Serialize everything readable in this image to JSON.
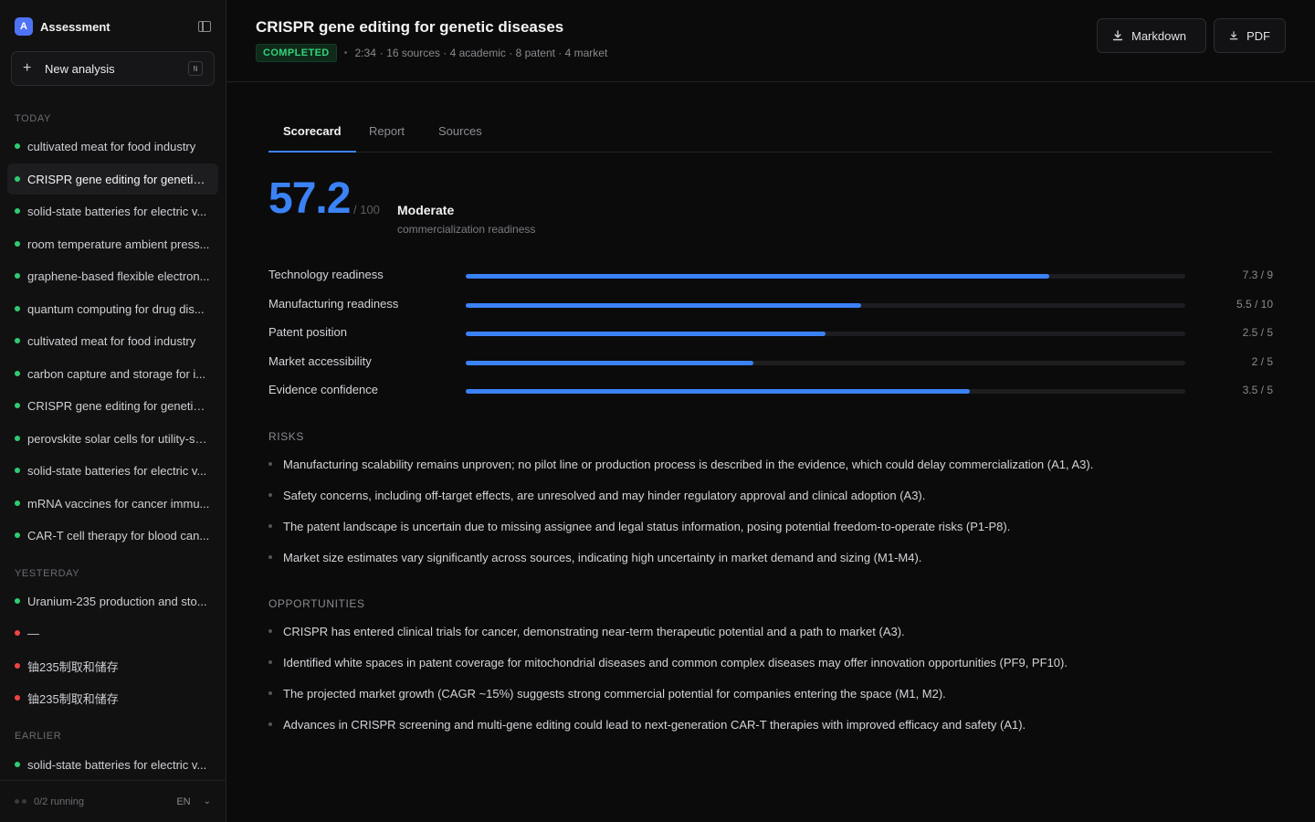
{
  "app": {
    "logo_letter": "A",
    "title": "Assessment"
  },
  "sidebar": {
    "new_analysis_label": "New analysis",
    "new_analysis_shortcut": "N",
    "sections": {
      "today": "TODAY",
      "yesterday": "YESTERDAY",
      "earlier": "EARLIER"
    },
    "today": [
      {
        "label": "cultivated meat for food industry",
        "status": "green"
      },
      {
        "label": "CRISPR gene editing for genetic ...",
        "status": "green",
        "active": true
      },
      {
        "label": "solid-state batteries for electric v...",
        "status": "green"
      },
      {
        "label": "room temperature ambient press...",
        "status": "green"
      },
      {
        "label": "graphene-based flexible electron...",
        "status": "green"
      },
      {
        "label": "quantum computing for drug dis...",
        "status": "green"
      },
      {
        "label": "cultivated meat for food industry",
        "status": "green"
      },
      {
        "label": "carbon capture and storage for i...",
        "status": "green"
      },
      {
        "label": "CRISPR gene editing for genetic ...",
        "status": "green"
      },
      {
        "label": "perovskite solar cells for utility-sc...",
        "status": "green"
      },
      {
        "label": "solid-state batteries for electric v...",
        "status": "green"
      },
      {
        "label": "mRNA vaccines for cancer immu...",
        "status": "green"
      },
      {
        "label": "CAR-T cell therapy for blood can...",
        "status": "green"
      }
    ],
    "yesterday": [
      {
        "label": "Uranium-235 production and sto...",
        "status": "green"
      },
      {
        "label": "—",
        "status": "red"
      },
      {
        "label": "铀235制取和储存",
        "status": "red"
      },
      {
        "label": "铀235制取和储存",
        "status": "red"
      }
    ],
    "earlier": [
      {
        "label": "solid-state batteries for electric v...",
        "status": "green"
      }
    ],
    "footer": {
      "running": "0/2 running",
      "language": "EN"
    }
  },
  "header": {
    "title": "CRISPR gene editing for genetic diseases",
    "status": "COMPLETED",
    "duration": "2:34",
    "sources_summary": "· 16 sources · 4 academic · 8 patent · 4 market",
    "buttons": {
      "markdown": "Markdown",
      "pdf": "PDF"
    }
  },
  "tabs": [
    "Scorecard",
    "Report",
    "Sources"
  ],
  "score": {
    "value": "57.2",
    "max": "/ 100",
    "level": "Moderate",
    "subtitle": "commercialization readiness"
  },
  "metrics": [
    {
      "label": "Technology readiness",
      "value": "7.3 / 9",
      "fraction": 0.811
    },
    {
      "label": "Manufacturing readiness",
      "value": "5.5 / 10",
      "fraction": 0.55
    },
    {
      "label": "Patent position",
      "value": "2.5 / 5",
      "fraction": 0.5
    },
    {
      "label": "Market accessibility",
      "value": "2 / 5",
      "fraction": 0.4
    },
    {
      "label": "Evidence confidence",
      "value": "3.5 / 5",
      "fraction": 0.7
    }
  ],
  "risks": {
    "heading": "RISKS",
    "items": [
      "Manufacturing scalability remains unproven; no pilot line or production process is described in the evidence, which could delay commercialization (A1, A3).",
      "Safety concerns, including off-target effects, are unresolved and may hinder regulatory approval and clinical adoption (A3).",
      "The patent landscape is uncertain due to missing assignee and legal status information, posing potential freedom-to-operate risks (P1-P8).",
      "Market size estimates vary significantly across sources, indicating high uncertainty in market demand and sizing (M1-M4)."
    ]
  },
  "opportunities": {
    "heading": "OPPORTUNITIES",
    "items": [
      "CRISPR has entered clinical trials for cancer, demonstrating near-term therapeutic potential and a path to market (A3).",
      "Identified white spaces in patent coverage for mitochondrial diseases and common complex diseases may offer innovation opportunities (PF9, PF10).",
      "The projected market growth (CAGR ~15%) suggests strong commercial potential for companies entering the space (M1, M2).",
      "Advances in CRISPR screening and multi-gene editing could lead to next-generation CAR-T therapies with improved efficacy and safety (A1)."
    ]
  }
}
